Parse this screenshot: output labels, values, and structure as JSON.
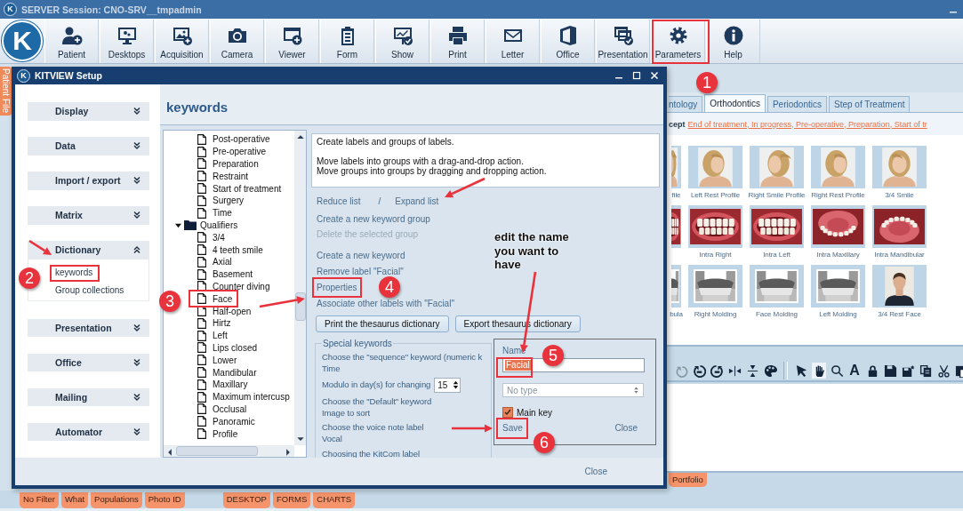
{
  "app": {
    "title_logo": "K",
    "logo": "K",
    "title": "SERVER Session: CNO-SRV__tmpadmin",
    "side_tab": "Patient File"
  },
  "toolbar": [
    "Patient",
    "Desktops",
    "Acquisition",
    "Camera",
    "Viewer",
    "Form",
    "Show",
    "Print",
    "Letter",
    "Office",
    "Presentation",
    "Parameters",
    "Help"
  ],
  "tabs": [
    {
      "label": "ntology",
      "selected": false
    },
    {
      "label": "Orthodontics",
      "selected": true
    },
    {
      "label": "Periodontics",
      "selected": false
    },
    {
      "label": "Step of Treatment",
      "selected": false
    }
  ],
  "filter": {
    "prefix": "cept",
    "link": "End of treatment, In progress, Pre-operative, Preparation, Start of tr"
  },
  "thumbnails": [
    [
      {
        "label": "file"
      },
      {
        "label": "Left Rest Profile"
      },
      {
        "label": "Right Smile Profile"
      },
      {
        "label": "Right Rest Profile"
      },
      {
        "label": "3/4 Smile"
      }
    ],
    [
      {
        "kind": "picture"
      },
      {
        "label": "Intra Right"
      },
      {
        "label": "Intra Left"
      },
      {
        "label": "Intra Maxillary"
      },
      {
        "label": "Intra Mandibular"
      }
    ],
    [
      {
        "label": "bula"
      },
      {
        "label": "Right Molding"
      },
      {
        "label": "Face Molding"
      },
      {
        "label": "Left Molding"
      },
      {
        "label": "3/4 Rest Face"
      }
    ]
  ],
  "image_tools": [
    {
      "selected": false,
      "disabled": true
    },
    {
      "selected": false,
      "disabled": false
    },
    {
      "selected": false,
      "disabled": false
    },
    {
      "selected": false,
      "disabled": false
    },
    {
      "selected": false,
      "disabled": false
    },
    {
      "selected": false,
      "disabled": false
    },
    {
      "selected": false,
      "disabled": false
    },
    {
      "selected": true,
      "disabled": false
    },
    {
      "selected": false,
      "disabled": false
    },
    {
      "selected": false,
      "disabled": false,
      "glyph": "A"
    },
    {
      "selected": false,
      "disabled": false
    },
    {
      "selected": false,
      "disabled": false
    },
    {
      "selected": false,
      "disabled": false
    },
    {
      "selected": false,
      "disabled": false
    },
    {
      "selected": false,
      "disabled": false
    },
    {
      "selected": false,
      "disabled": false
    }
  ],
  "portfolio_tab": "Portfolio",
  "bottom_tabs": [
    [
      "No Filter",
      "What",
      "Populations",
      "Photo ID"
    ],
    [
      "DESKTOP",
      "FORMS",
      "CHARTS"
    ]
  ],
  "dialog": {
    "logo": "K",
    "title": "KITVIEW Setup",
    "nav": [
      {
        "label": "Display",
        "expanded": false
      },
      {
        "label": "Data",
        "expanded": false
      },
      {
        "label": "Import / export",
        "expanded": false
      },
      {
        "label": "Matrix",
        "expanded": false
      },
      {
        "label": "Dictionary",
        "expanded": true,
        "children": [
          "keywords",
          "Group collections"
        ]
      },
      {
        "label": "Presentation",
        "expanded": false
      },
      {
        "label": "Office",
        "expanded": false
      },
      {
        "label": "Mailing",
        "expanded": false
      },
      {
        "label": "Automator",
        "expanded": false
      }
    ],
    "heading": "keywords",
    "tree": {
      "items": [
        {
          "label": "Post-operative"
        },
        {
          "label": "Pre-operative"
        },
        {
          "label": "Preparation"
        },
        {
          "label": "Restraint"
        },
        {
          "label": "Start of treatment"
        },
        {
          "label": "Surgery"
        },
        {
          "label": "Time"
        }
      ],
      "folders": [
        {
          "label": "Qualifiers",
          "expanded": true,
          "children": [
            {
              "label": "3/4"
            },
            {
              "label": "4 teeth smile"
            },
            {
              "label": "Axial"
            },
            {
              "label": "Basement"
            },
            {
              "label": "Counter diving"
            },
            {
              "label": "Face"
            },
            {
              "label": "Half-open"
            },
            {
              "label": "Hirtz"
            },
            {
              "label": "Left"
            },
            {
              "label": "Lips closed"
            },
            {
              "label": "Lower"
            },
            {
              "label": "Mandibular"
            },
            {
              "label": "Maxillary"
            },
            {
              "label": "Maximum intercusp"
            },
            {
              "label": "Occlusal"
            },
            {
              "label": "Panoramic"
            },
            {
              "label": "Profile"
            }
          ]
        }
      ]
    },
    "description": [
      [
        "Create labels and groups of labels."
      ],
      [
        "Move labels into groups with a drag-and-drop action.",
        "Move groups into groups by dragging and dropping action."
      ]
    ],
    "list_links": [
      "Reduce list",
      "/",
      "Expand list"
    ],
    "actions": [
      [
        {
          "label": "Create a new keyword group",
          "disabled": false
        },
        {
          "label": "Delete the selected group",
          "disabled": true
        }
      ],
      [
        {
          "label": "Create a new keyword",
          "disabled": false
        },
        {
          "label": "Remove label \"Facial\"",
          "disabled": false
        },
        {
          "label": "Properties",
          "disabled": false
        },
        {
          "label": "Associate other labels with \"Facial\"",
          "disabled": false
        }
      ]
    ],
    "buttons": [
      "Print the thesaurus dictionary",
      "Export thesaurus dictionary"
    ],
    "special_keywords": {
      "title": "Special keywords",
      "rows": [
        {
          "kind": "pair",
          "label": "Choose the \"sequence\" keyword (numeric k",
          "value": "Time"
        },
        {
          "kind": "spin",
          "label": "Modulo in day(s) for changing",
          "value": "15"
        },
        {
          "kind": "pair",
          "label": "Choose the \"Default\" keyword",
          "value": "Image to sort"
        },
        {
          "kind": "pair",
          "label": "Choose the voice note label",
          "value": "Vocal"
        },
        {
          "kind": "label",
          "label": "Choosing the KitCom label"
        }
      ]
    },
    "properties": {
      "name_label": "Name",
      "name_value": "Facial",
      "type_placeholder": "No type",
      "main_key": {
        "label": "Main key",
        "checked": true
      },
      "save": "Save",
      "close": "Close"
    },
    "close": "Close"
  },
  "annotations": {
    "steps": [
      "1",
      "2",
      "3",
      "4",
      "5",
      "6"
    ],
    "callout": "edit the name you want to have"
  }
}
